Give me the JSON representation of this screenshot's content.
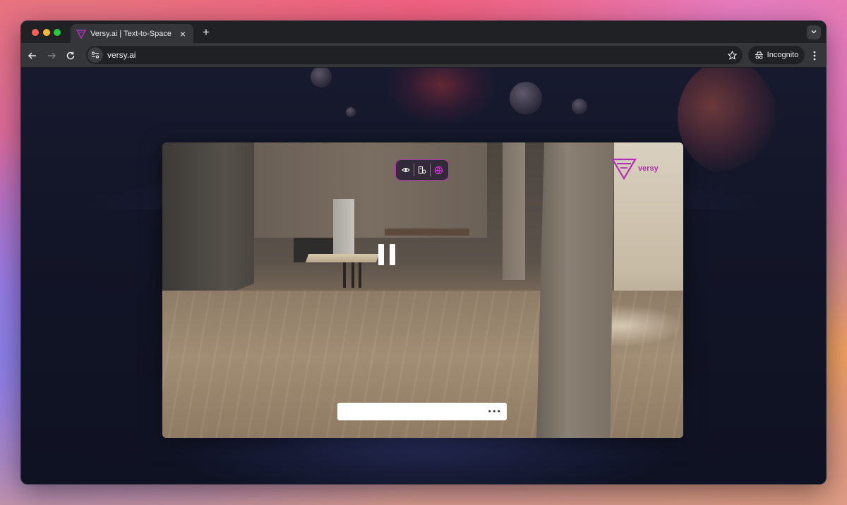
{
  "browser": {
    "tab_title": "Versy.ai | Text-to-Space",
    "new_tab_symbol": "+",
    "close_symbol": "×",
    "url": "versy.ai",
    "incognito_label": "Incognito",
    "icons": {
      "back": "arrow-left-icon",
      "forward": "arrow-right-icon",
      "reload": "reload-icon",
      "site_info": "tune-icon",
      "bookmark": "star-icon",
      "menu": "three-dots-vertical-icon",
      "tab_search": "chevron-down-icon",
      "incognito": "incognito-icon"
    }
  },
  "app": {
    "brand_color": "#b02fb5",
    "logo_text": "versy",
    "controls": [
      {
        "name": "view",
        "icon": "eye-icon"
      },
      {
        "name": "assets",
        "icon": "box-tag-icon"
      },
      {
        "name": "settings",
        "icon": "globe-icon"
      }
    ],
    "playback_state": "paused",
    "prompt": {
      "value": "",
      "more_symbol": "•••"
    }
  }
}
